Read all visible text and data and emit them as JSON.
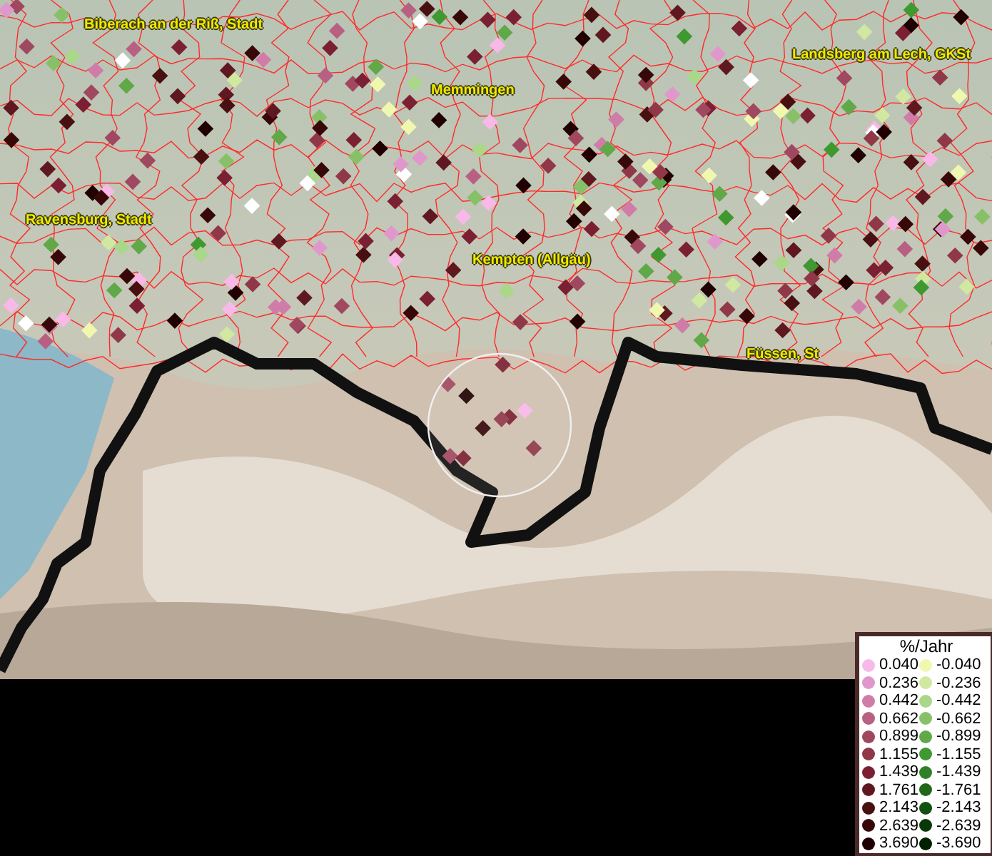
{
  "map": {
    "places": [
      {
        "name": "Biberach an der Riß, Stadt"
      },
      {
        "name": "Memmingen"
      },
      {
        "name": "Landsberg am Lech, GKSt"
      },
      {
        "name": "Ravensburg, Stadt"
      },
      {
        "name": "Kempten (Allgäu)"
      },
      {
        "name": "Füssen, St"
      }
    ]
  },
  "legend": {
    "title": "%/Jahr",
    "positive": [
      {
        "label": "0.040",
        "color": "#f8b8e8"
      },
      {
        "label": "0.236",
        "color": "#e098cc"
      },
      {
        "label": "0.442",
        "color": "#d07ca8"
      },
      {
        "label": "0.662",
        "color": "#b86082"
      },
      {
        "label": "0.899",
        "color": "#a04860"
      },
      {
        "label": "1.155",
        "color": "#903848"
      },
      {
        "label": "1.439",
        "color": "#7a2032"
      },
      {
        "label": "1.761",
        "color": "#601820"
      },
      {
        "label": "2.143",
        "color": "#481010"
      },
      {
        "label": "2.639",
        "color": "#380808"
      },
      {
        "label": "3.690",
        "color": "#200000"
      }
    ],
    "negative": [
      {
        "label": "-0.040",
        "color": "#f0f8b0"
      },
      {
        "label": "-0.236",
        "color": "#d0e8a0"
      },
      {
        "label": "-0.442",
        "color": "#a8d888"
      },
      {
        "label": "-0.662",
        "color": "#88c068"
      },
      {
        "label": "-0.899",
        "color": "#60a848"
      },
      {
        "label": "-1.155",
        "color": "#409830"
      },
      {
        "label": "-1.439",
        "color": "#308028"
      },
      {
        "label": "-1.761",
        "color": "#206818"
      },
      {
        "label": "-2.143",
        "color": "#105010"
      },
      {
        "label": "-2.639",
        "color": "#083808"
      },
      {
        "label": "-3.690",
        "color": "#002000"
      }
    ]
  }
}
